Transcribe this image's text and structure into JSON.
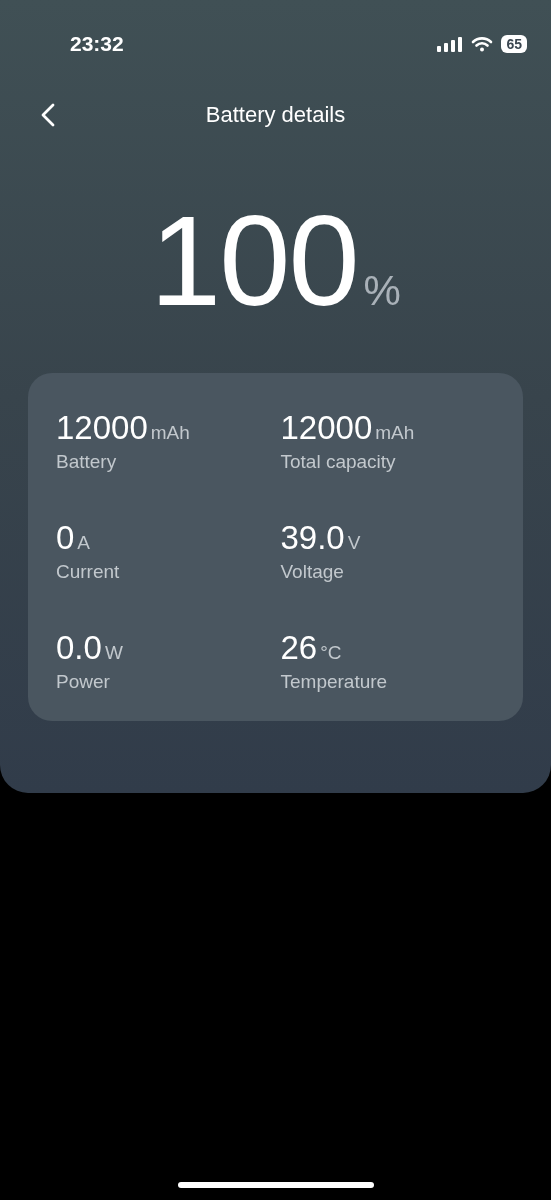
{
  "status_bar": {
    "time": "23:32",
    "battery": "65"
  },
  "header": {
    "title": "Battery details"
  },
  "charge": {
    "value": "100",
    "unit": "%"
  },
  "stats": [
    {
      "value": "12000",
      "unit": "mAh",
      "label": "Battery"
    },
    {
      "value": "12000",
      "unit": "mAh",
      "label": "Total capacity"
    },
    {
      "value": "0",
      "unit": "A",
      "label": "Current"
    },
    {
      "value": "39.0",
      "unit": "V",
      "label": "Voltage"
    },
    {
      "value": "0.0",
      "unit": "W",
      "label": "Power"
    },
    {
      "value": "26",
      "unit": "°C",
      "label": "Temperature"
    }
  ]
}
